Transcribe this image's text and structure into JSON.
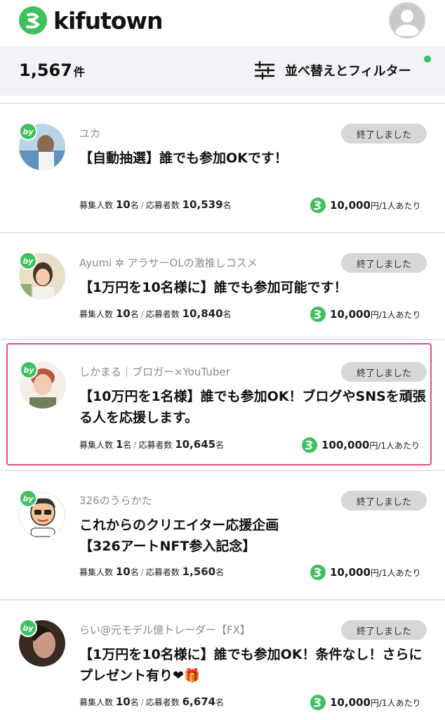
{
  "header": {
    "logo_text": "kifutown",
    "avatar_icon": "user-avatar-icon"
  },
  "toolbar": {
    "count": "1,567",
    "count_unit": "件",
    "sort_label": "並べ替えとフィルター",
    "sort_icon": "sliders-icon",
    "indicator_color": "#36c26b"
  },
  "colors": {
    "accent_green": "#3fbf5f",
    "badge_bg": "#d7d7d7",
    "highlight_border": "#e1507c"
  },
  "labels": {
    "by": "by",
    "status": "終了しました",
    "recruit_label": "募集人数",
    "recruit_unit": "名",
    "applicant_label": "応募者数",
    "applicant_unit": "名",
    "amount_unit": "円",
    "per_person": "/1人あたり"
  },
  "campaigns": [
    {
      "author": "ユカ",
      "title": "【自動抽選】誰でも参加OKです！",
      "recruit": "10",
      "applicants": "10,539",
      "amount": "10,000"
    },
    {
      "author": "Ayumi ✲ アラサーOLの激推しコスメ",
      "title": "【1万円を10名様に】誰でも参加可能です！",
      "recruit": "10",
      "applicants": "10,840",
      "amount": "10,000"
    },
    {
      "author": "しかまる｜ブロガー×YouTuber",
      "title": "【10万円を1名様】誰でも参加OK！ブログやSNSを頑張る人を応援します。",
      "recruit": "1",
      "applicants": "10,645",
      "amount": "100,000"
    },
    {
      "author": "326のうらかた",
      "title_line1": "これからのクリエイター応援企画",
      "title_line2": "【326アートNFT参入記念】",
      "recruit": "10",
      "applicants": "1,560",
      "amount": "10,000"
    },
    {
      "author": "らい@元モデル億トレーダー【FX】",
      "title": "【1万円を10名様に】誰でも参加OK！条件なし！さらにプレゼント有り❤🎁",
      "recruit": "10",
      "applicants": "6,674",
      "amount": "10,000"
    }
  ]
}
